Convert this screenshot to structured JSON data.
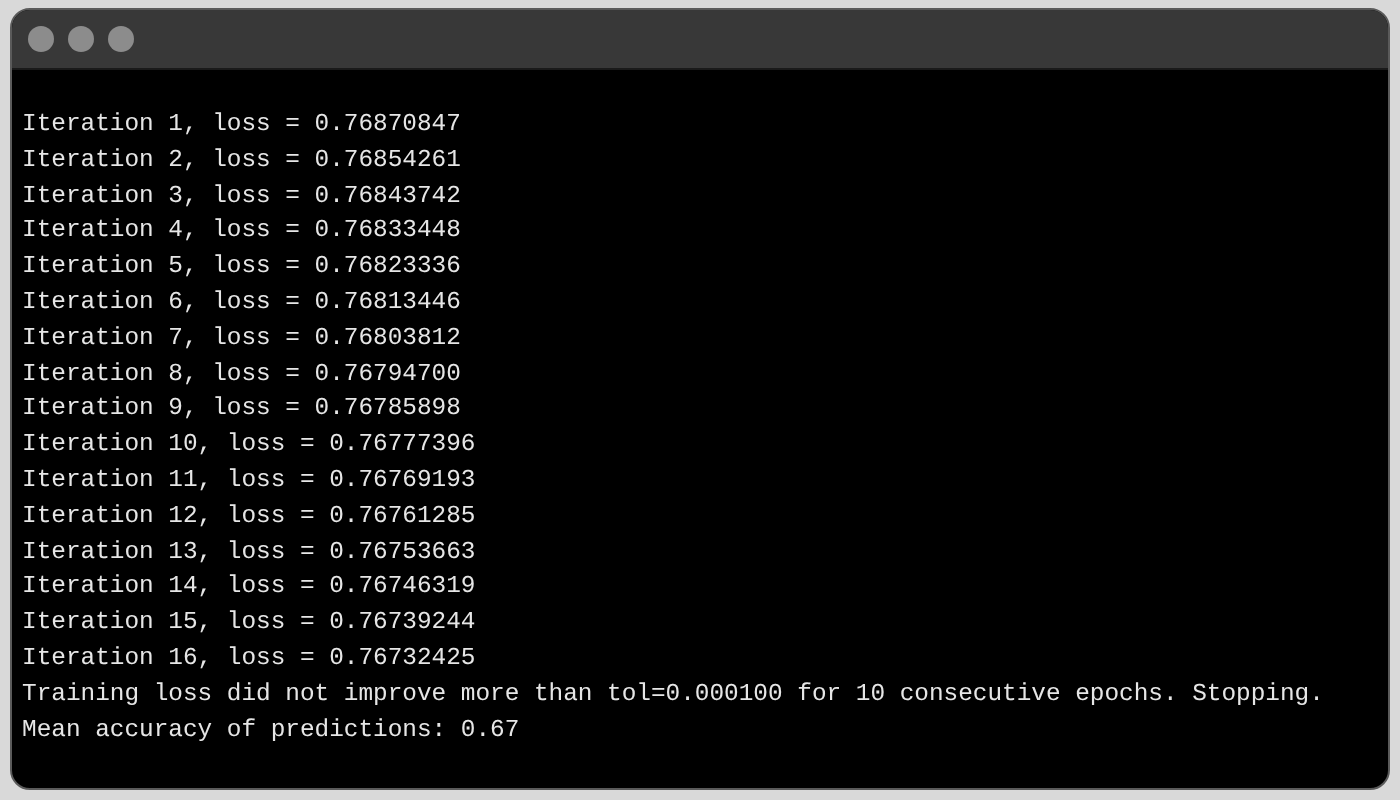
{
  "console": {
    "lines": [
      "Iteration 1, loss = 0.76870847",
      "Iteration 2, loss = 0.76854261",
      "Iteration 3, loss = 0.76843742",
      "Iteration 4, loss = 0.76833448",
      "Iteration 5, loss = 0.76823336",
      "Iteration 6, loss = 0.76813446",
      "Iteration 7, loss = 0.76803812",
      "Iteration 8, loss = 0.76794700",
      "Iteration 9, loss = 0.76785898",
      "Iteration 10, loss = 0.76777396",
      "Iteration 11, loss = 0.76769193",
      "Iteration 12, loss = 0.76761285",
      "Iteration 13, loss = 0.76753663",
      "Iteration 14, loss = 0.76746319",
      "Iteration 15, loss = 0.76739244",
      "Iteration 16, loss = 0.76732425",
      "Training loss did not improve more than tol=0.000100 for 10 consecutive epochs. Stopping.",
      "Mean accuracy of predictions: 0.67"
    ]
  }
}
